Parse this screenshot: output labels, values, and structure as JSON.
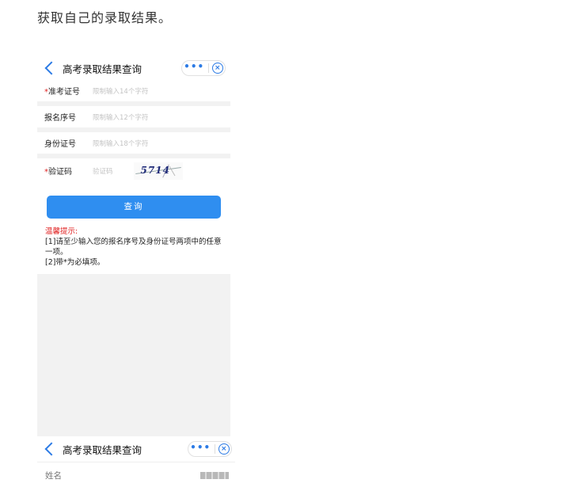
{
  "article": {
    "text": "获取自己的录取结果。"
  },
  "screen1": {
    "title": "高考录取结果查询",
    "fields": [
      {
        "required": true,
        "label": "准考证号",
        "placeholder": "限制输入14个字符"
      },
      {
        "required": false,
        "label": "报名序号",
        "placeholder": "限制输入12个字符"
      },
      {
        "required": false,
        "label": "身份证号",
        "placeholder": "限制输入18个字符"
      }
    ],
    "captcha": {
      "required": true,
      "label": "验证码",
      "placeholder": "验证码",
      "code": "5714"
    },
    "query_button": "查询",
    "tips": {
      "title": "温馨提示:",
      "line1": "[1]请至少输入您的报名序号及身份证号两项中的任意一项。",
      "line2": "[2]带*为必填项。"
    }
  },
  "screen2": {
    "title": "高考录取结果查询",
    "name_label": "姓名"
  },
  "colors": {
    "accent": "#2f8ef0",
    "required": "#e02020"
  }
}
